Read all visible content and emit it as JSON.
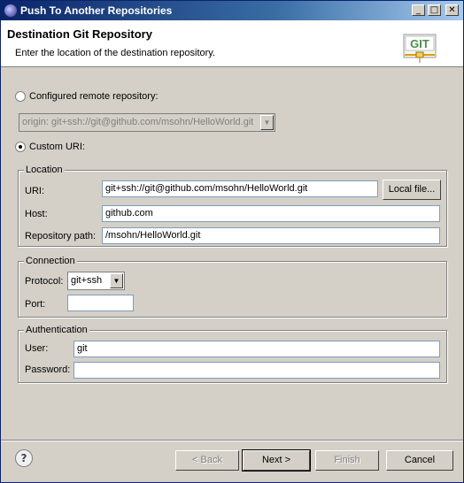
{
  "window": {
    "title": "Push To Another Repositories",
    "controls": {
      "minimize": "_",
      "maximize": "□",
      "close": "✕"
    }
  },
  "banner": {
    "title": "Destination Git Repository",
    "message": "Enter the location of the destination repository.",
    "logo_text": "GIT"
  },
  "source": {
    "configured_label": "Configured remote repository:",
    "configured_selected": false,
    "configured_value": "origin: git+ssh://git@github.com/msohn/HelloWorld.git",
    "custom_label": "Custom URI:",
    "custom_selected": true
  },
  "location": {
    "legend": "Location",
    "uri_label": "URI:",
    "uri_value": "git+ssh://git@github.com/msohn/HelloWorld.git",
    "local_file_label": "Local file...",
    "host_label": "Host:",
    "host_value": "github.com",
    "path_label": "Repository path:",
    "path_value": "/msohn/HelloWorld.git"
  },
  "connection": {
    "legend": "Connection",
    "protocol_label": "Protocol:",
    "protocol_value": "git+ssh",
    "port_label": "Port:",
    "port_value": ""
  },
  "authentication": {
    "legend": "Authentication",
    "user_label": "User:",
    "user_value": "git",
    "password_label": "Password:",
    "password_value": ""
  },
  "footer": {
    "help_icon": "?",
    "back_label": "< Back",
    "next_label": "Next >",
    "finish_label": "Finish",
    "cancel_label": "Cancel"
  }
}
